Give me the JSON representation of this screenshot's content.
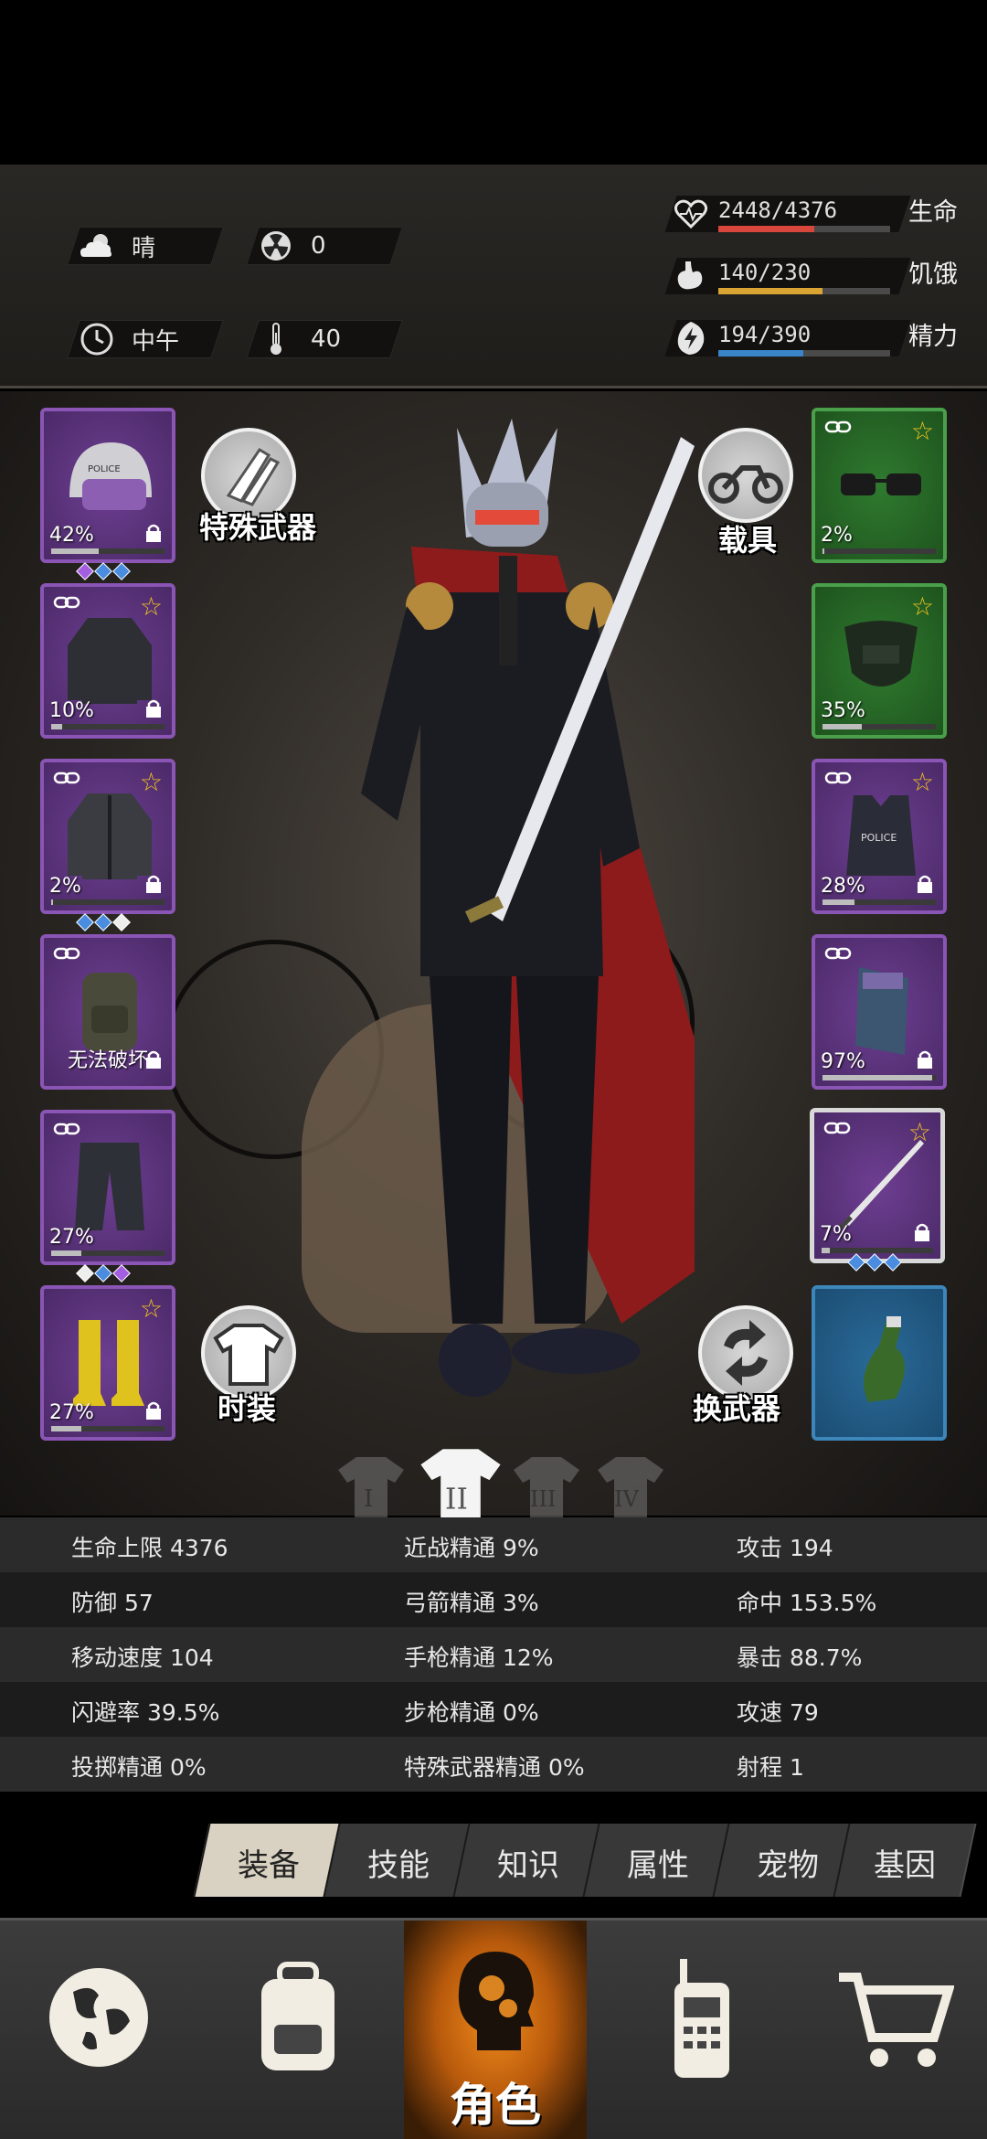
{
  "hud": {
    "weather": {
      "icon": "cloud-sun-icon",
      "label": "晴"
    },
    "radiation": {
      "icon": "radiation-icon",
      "value": "0"
    },
    "time": {
      "icon": "clock-icon",
      "label": "中午"
    },
    "temperature": {
      "icon": "thermometer-icon",
      "value": "40"
    },
    "vitals": [
      {
        "icon": "heart-icon",
        "value": "2448/4376",
        "label": "生命",
        "fraction": 0.559,
        "color": "#d9473c"
      },
      {
        "icon": "stomach-icon",
        "value": "140/230",
        "label": "饥饿",
        "fraction": 0.609,
        "color": "#d9a431"
      },
      {
        "icon": "energy-icon",
        "value": "194/390",
        "label": "精力",
        "fraction": 0.497,
        "color": "#3a84c9"
      }
    ]
  },
  "equipment": {
    "left": [
      {
        "name": "police-helmet",
        "pct": "42%",
        "durability": 0.42
      },
      {
        "name": "sweater",
        "pct": "10%",
        "durability": 0.1
      },
      {
        "name": "jacket",
        "pct": "2%",
        "durability": 0.02
      },
      {
        "name": "backpack",
        "message": "无法破坏"
      },
      {
        "name": "pants",
        "pct": "27%",
        "durability": 0.27
      },
      {
        "name": "rain-boots",
        "pct": "27%",
        "durability": 0.27
      }
    ],
    "right": [
      {
        "name": "glasses",
        "pct": "2%",
        "durability": 0.02
      },
      {
        "name": "gas-mask",
        "pct": "35%",
        "durability": 0.35
      },
      {
        "name": "police-vest",
        "pct": "28%",
        "durability": 0.28
      },
      {
        "name": "shield",
        "pct": "97%",
        "durability": 0.97
      },
      {
        "name": "katana",
        "pct": "7%",
        "durability": 0.07
      },
      {
        "name": "molotov"
      }
    ],
    "buttons": {
      "special_weapon": "特殊武器",
      "vehicle": "载具",
      "fashion": "时装",
      "switch_weapon": "换武器"
    },
    "outfit_sets": [
      "I",
      "II",
      "III",
      "IV"
    ]
  },
  "stats": [
    [
      "生命上限 4376",
      "近战精通 9%",
      "攻击 194"
    ],
    [
      "防御 57",
      "弓箭精通 3%",
      "命中 153.5%"
    ],
    [
      "移动速度 104",
      "手枪精通 12%",
      "暴击 88.7%"
    ],
    [
      "闪避率 39.5%",
      "步枪精通 0%",
      "攻速 79"
    ],
    [
      "投掷精通 0%",
      "特殊武器精通 0%",
      "射程 1"
    ]
  ],
  "tabs": [
    "装备",
    "技能",
    "知识",
    "属性",
    "宠物",
    "基因"
  ],
  "nav": {
    "world": "globe-icon",
    "inventory": "backpack-icon",
    "character": "角色",
    "radio": "walkie-talkie-icon",
    "shop": "cart-icon"
  }
}
